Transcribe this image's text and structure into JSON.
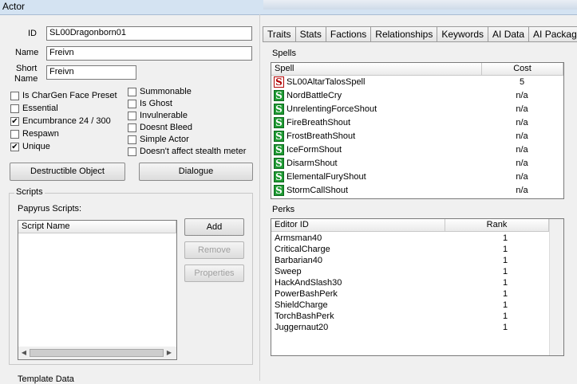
{
  "window": {
    "title": "Actor"
  },
  "form": {
    "id_label": "ID",
    "id_value": "SL00Dragonborn01",
    "name_label": "Name",
    "name_value": "Freivn",
    "short_name_label_1": "Short",
    "short_name_label_2": "Name",
    "short_name_value": "Freivn"
  },
  "checkboxes_left": [
    {
      "label": "Is CharGen Face Preset",
      "checked": false
    },
    {
      "label": "Essential",
      "checked": false
    },
    {
      "label": "Encumbrance 24 / 300",
      "checked": true
    },
    {
      "label": "Respawn",
      "checked": false
    },
    {
      "label": "Unique",
      "checked": true
    }
  ],
  "checkboxes_right": [
    {
      "label": "Summonable",
      "checked": false
    },
    {
      "label": "Is Ghost",
      "checked": false
    },
    {
      "label": "Invulnerable",
      "checked": false
    },
    {
      "label": "Doesnt Bleed",
      "checked": false
    },
    {
      "label": "Simple Actor",
      "checked": false
    },
    {
      "label": "Doesn't affect stealth meter",
      "checked": false
    }
  ],
  "buttons": {
    "destructible": "Destructible Object",
    "dialogue": "Dialogue",
    "add": "Add",
    "remove": "Remove",
    "properties": "Properties"
  },
  "scripts": {
    "group_title": "Scripts",
    "papyrus_label": "Papyrus Scripts:",
    "column_script_name": "Script Name"
  },
  "template_label": "Template Data",
  "tabs": [
    "Traits",
    "Stats",
    "Factions",
    "Relationships",
    "Keywords",
    "AI Data",
    "AI Packages"
  ],
  "spells": {
    "section_label": "Spells",
    "col_spell": "Spell",
    "col_cost": "Cost",
    "rows": [
      {
        "name": "SL00AltarTalosSpell",
        "cost": "5",
        "icon": "red"
      },
      {
        "name": "NordBattleCry",
        "cost": "n/a",
        "icon": "green"
      },
      {
        "name": "UnrelentingForceShout",
        "cost": "n/a",
        "icon": "green"
      },
      {
        "name": "FireBreathShout",
        "cost": "n/a",
        "icon": "green"
      },
      {
        "name": "FrostBreathShout",
        "cost": "n/a",
        "icon": "green"
      },
      {
        "name": "IceFormShout",
        "cost": "n/a",
        "icon": "green"
      },
      {
        "name": "DisarmShout",
        "cost": "n/a",
        "icon": "green"
      },
      {
        "name": "ElementalFuryShout",
        "cost": "n/a",
        "icon": "green"
      },
      {
        "name": "StormCallShout",
        "cost": "n/a",
        "icon": "green"
      }
    ]
  },
  "perks": {
    "section_label": "Perks",
    "col_editor_id": "Editor ID",
    "col_rank": "Rank",
    "rows": [
      {
        "name": "Armsman40",
        "rank": "1"
      },
      {
        "name": "CriticalCharge",
        "rank": "1"
      },
      {
        "name": "Barbarian40",
        "rank": "1"
      },
      {
        "name": "Sweep",
        "rank": "1"
      },
      {
        "name": "HackAndSlash30",
        "rank": "1"
      },
      {
        "name": "PowerBashPerk",
        "rank": "1"
      },
      {
        "name": "ShieldCharge",
        "rank": "1"
      },
      {
        "name": "TorchBashPerk",
        "rank": "1"
      },
      {
        "name": "Juggernaut20",
        "rank": "1"
      }
    ]
  },
  "spell_icon_glyph": "S"
}
